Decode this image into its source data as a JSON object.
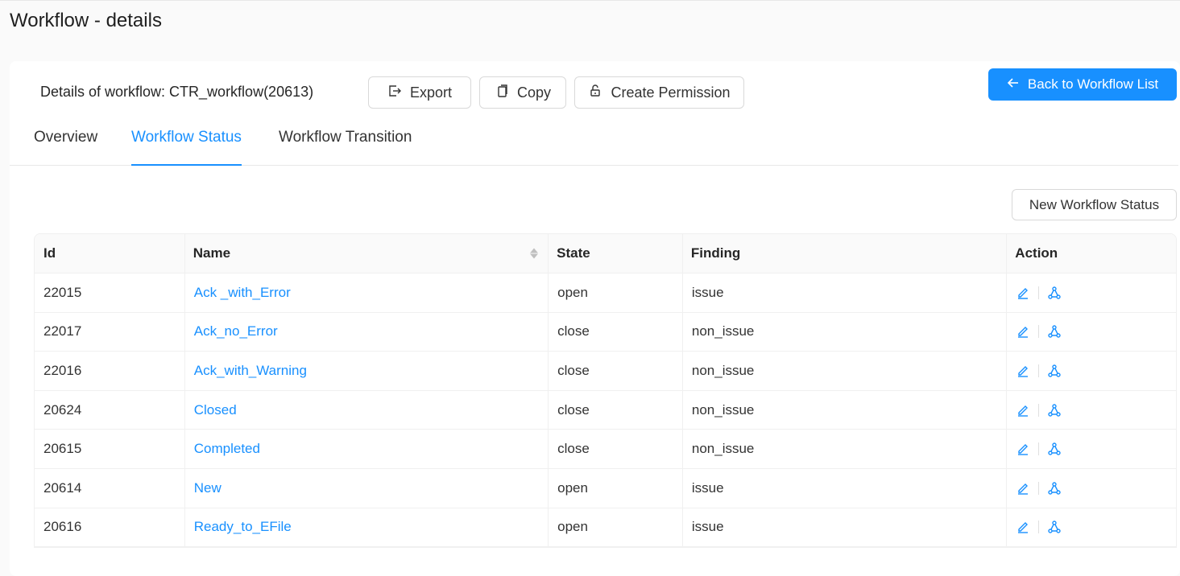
{
  "page": {
    "title": "Workflow - details"
  },
  "header": {
    "details_label": "Details of workflow: CTR_workflow(20613)",
    "export_label": "Export",
    "copy_label": "Copy",
    "create_permission_label": "Create Permission",
    "back_label": "Back to Workflow List"
  },
  "tabs": [
    {
      "label": "Overview",
      "active": false
    },
    {
      "label": "Workflow Status",
      "active": true
    },
    {
      "label": "Workflow Transition",
      "active": false
    }
  ],
  "toolbar": {
    "new_status_label": "New Workflow Status"
  },
  "table": {
    "columns": [
      "Id",
      "Name",
      "State",
      "Finding",
      "Action"
    ],
    "rows": [
      {
        "id": "22015",
        "name": "Ack _with_Error",
        "state": "open",
        "finding": "issue"
      },
      {
        "id": "22017",
        "name": "Ack_no_Error",
        "state": "close",
        "finding": "non_issue"
      },
      {
        "id": "22016",
        "name": "Ack_with_Warning",
        "state": "close",
        "finding": "non_issue"
      },
      {
        "id": "20624",
        "name": "Closed",
        "state": "close",
        "finding": "non_issue"
      },
      {
        "id": "20615",
        "name": "Completed",
        "state": "close",
        "finding": "non_issue"
      },
      {
        "id": "20614",
        "name": "New",
        "state": "open",
        "finding": "issue"
      },
      {
        "id": "20616",
        "name": "Ready_to_EFile",
        "state": "open",
        "finding": "issue"
      }
    ]
  },
  "colors": {
    "accent": "#1890ff",
    "border": "#d9d9d9",
    "header_bg": "#fafafa"
  },
  "icons": {
    "export": "export-icon",
    "copy": "copy-icon",
    "permission": "lock-icon",
    "back": "arrow-left-icon",
    "edit": "edit-icon",
    "transition": "nodes-icon",
    "sort": "sort-icon"
  }
}
